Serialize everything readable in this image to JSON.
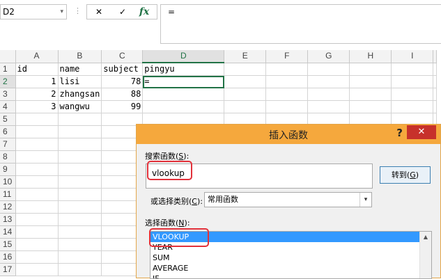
{
  "formula_bar": {
    "name_box": "D2",
    "name_box_dropdown_glyph": "▾",
    "separator_glyph": "⋮",
    "cancel_glyph": "✕",
    "enter_glyph": "✓",
    "fx_label": "fx",
    "formula": "="
  },
  "sheet": {
    "columns": [
      "A",
      "B",
      "C",
      "D",
      "E",
      "F",
      "G",
      "H",
      "I"
    ],
    "selected_column": "D",
    "selected_row": "2",
    "rows": [
      {
        "n": "1",
        "cells": [
          "id",
          "name",
          "subject",
          "pingyu",
          "",
          "",
          "",
          "",
          ""
        ]
      },
      {
        "n": "2",
        "cells": [
          "1",
          "lisi",
          "78",
          "=",
          "",
          "",
          "",
          "",
          ""
        ]
      },
      {
        "n": "3",
        "cells": [
          "2",
          "zhangsan",
          "88",
          "",
          "",
          "",
          "",
          "",
          ""
        ]
      },
      {
        "n": "4",
        "cells": [
          "3",
          "wangwu",
          "99",
          "",
          "",
          "",
          "",
          "",
          ""
        ]
      },
      {
        "n": "5",
        "cells": [
          "",
          "",
          "",
          "",
          "",
          "",
          "",
          "",
          ""
        ]
      },
      {
        "n": "6",
        "cells": [
          "",
          "",
          "",
          "",
          "",
          "",
          "",
          "",
          ""
        ]
      },
      {
        "n": "7",
        "cells": [
          "",
          "",
          "",
          "",
          "",
          "",
          "",
          "",
          ""
        ]
      },
      {
        "n": "8",
        "cells": [
          "",
          "",
          "",
          "",
          "",
          "",
          "",
          "",
          ""
        ]
      },
      {
        "n": "9",
        "cells": [
          "",
          "",
          "",
          "",
          "",
          "",
          "",
          "",
          ""
        ]
      },
      {
        "n": "10",
        "cells": [
          "",
          "",
          "",
          "",
          "",
          "",
          "",
          "",
          ""
        ]
      },
      {
        "n": "11",
        "cells": [
          "",
          "",
          "",
          "",
          "",
          "",
          "",
          "",
          ""
        ]
      },
      {
        "n": "12",
        "cells": [
          "",
          "",
          "",
          "",
          "",
          "",
          "",
          "",
          ""
        ]
      },
      {
        "n": "13",
        "cells": [
          "",
          "",
          "",
          "",
          "",
          "",
          "",
          "",
          ""
        ]
      },
      {
        "n": "14",
        "cells": [
          "",
          "",
          "",
          "",
          "",
          "",
          "",
          "",
          ""
        ]
      },
      {
        "n": "15",
        "cells": [
          "",
          "",
          "",
          "",
          "",
          "",
          "",
          "",
          ""
        ]
      },
      {
        "n": "16",
        "cells": [
          "",
          "",
          "",
          "",
          "",
          "",
          "",
          "",
          ""
        ]
      },
      {
        "n": "17",
        "cells": [
          "",
          "",
          "",
          "",
          "",
          "",
          "",
          "",
          ""
        ]
      }
    ]
  },
  "dialog": {
    "title": "插入函数",
    "help_glyph": "?",
    "close_glyph": "✕",
    "search_label_prefix": "搜索函数(",
    "search_label_key": "S",
    "search_label_suffix": "):",
    "search_value": "vlookup",
    "go_button_prefix": "转到(",
    "go_button_key": "G",
    "go_button_suffix": ")",
    "category_label_prefix": "或选择类别(",
    "category_label_key": "C",
    "category_label_suffix": "):",
    "category_value": "常用函数",
    "category_arrow": "▾",
    "function_label_prefix": "选择函数(",
    "function_label_key": "N",
    "function_label_suffix": "):",
    "functions": [
      "VLOOKUP",
      "YEAR",
      "SUM",
      "AVERAGE",
      "IF"
    ],
    "selected_function": "VLOOKUP",
    "scroll_up_glyph": "▲"
  },
  "colors": {
    "excel_green": "#217346",
    "dialog_title_orange": "#f5a83d",
    "close_red": "#c7312b",
    "selection_blue": "#3399ff",
    "highlight_red": "#e2313a"
  }
}
